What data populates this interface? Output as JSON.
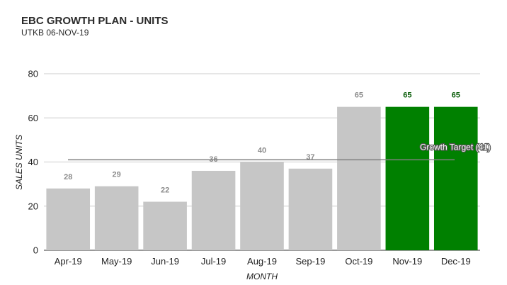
{
  "header": {
    "title": "EBC GROWTH PLAN - UNITS",
    "subtitle": "UTKB 06-NOV-19"
  },
  "chart_data": {
    "type": "bar",
    "categories": [
      "Apr-19",
      "May-19",
      "Jun-19",
      "Jul-19",
      "Aug-19",
      "Sep-19",
      "Oct-19",
      "Nov-19",
      "Dec-19"
    ],
    "values": [
      28,
      29,
      22,
      36,
      40,
      37,
      65,
      65,
      65
    ],
    "data_labels": [
      "28",
      "29",
      "22",
      "36",
      "40",
      "37",
      "65",
      "65",
      "65"
    ],
    "bar_colors": [
      "#c6c6c6",
      "#c6c6c6",
      "#c6c6c6",
      "#c6c6c6",
      "#c6c6c6",
      "#c6c6c6",
      "#c6c6c6",
      "#008000",
      "#008000"
    ],
    "label_colors": [
      "#8c8c8c",
      "#8c8c8c",
      "#8c8c8c",
      "#8c8c8c",
      "#8c8c8c",
      "#8c8c8c",
      "#8c8c8c",
      "#0b5e0b",
      "#0b5e0b"
    ],
    "xlabel": "MONTH",
    "ylabel": "SALES UNITS",
    "ylim": [
      0,
      80
    ],
    "yticks": [
      0,
      20,
      40,
      60,
      80
    ],
    "grid": true,
    "reference_line": {
      "label": "Growth Target (41)",
      "value": 41,
      "color": "#808080"
    }
  }
}
